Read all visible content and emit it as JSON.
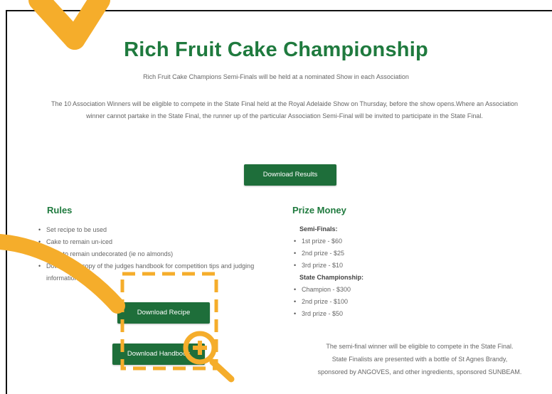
{
  "page": {
    "title": "Rich Fruit Cake Championship",
    "subtitle": "Rich Fruit Cake Champions Semi-Finals will be held at a nominated Show in each Association",
    "intro": "The 10 Association Winners will be eligible to compete in the State Final held at the Royal Adelaide Show on Thursday, before the show opens.Where an Association winner cannot partake in the State Final, the runner up of the particular Association Semi-Final will be invited to participate in the State Final.",
    "download_results_label": "Download Results"
  },
  "rules": {
    "heading": "Rules",
    "items": [
      "Set recipe to be used",
      "Cake to remain un-iced",
      "Cake to remain undecorated (ie no almonds)",
      "Download a copy of the judges handbook for competition tips and judging information"
    ],
    "download_recipe_label": "Download Recipe",
    "download_handbook_label": "Download Handbook"
  },
  "prize_money": {
    "heading": "Prize Money",
    "semi_finals_label": "Semi-Finals:",
    "semi_finals": [
      "1st prize - $60",
      "2nd prize - $25",
      "3rd prize - $10"
    ],
    "state_label": "State Championship:",
    "state": [
      "Champion - $300",
      "2nd prize - $100",
      "3rd prize - $50"
    ],
    "note_line1": "The semi-final winner will be eligible to compete in the State Final.",
    "note_line2": "State Finalists are presented with a bottle of St Agnes Brandy,",
    "note_line3": "sponsored by ANGOVES, and other ingredients, sponsored SUNBEAM."
  },
  "annotation": {
    "color": "#f5ad2b",
    "icon": "zoom-in-icon"
  }
}
